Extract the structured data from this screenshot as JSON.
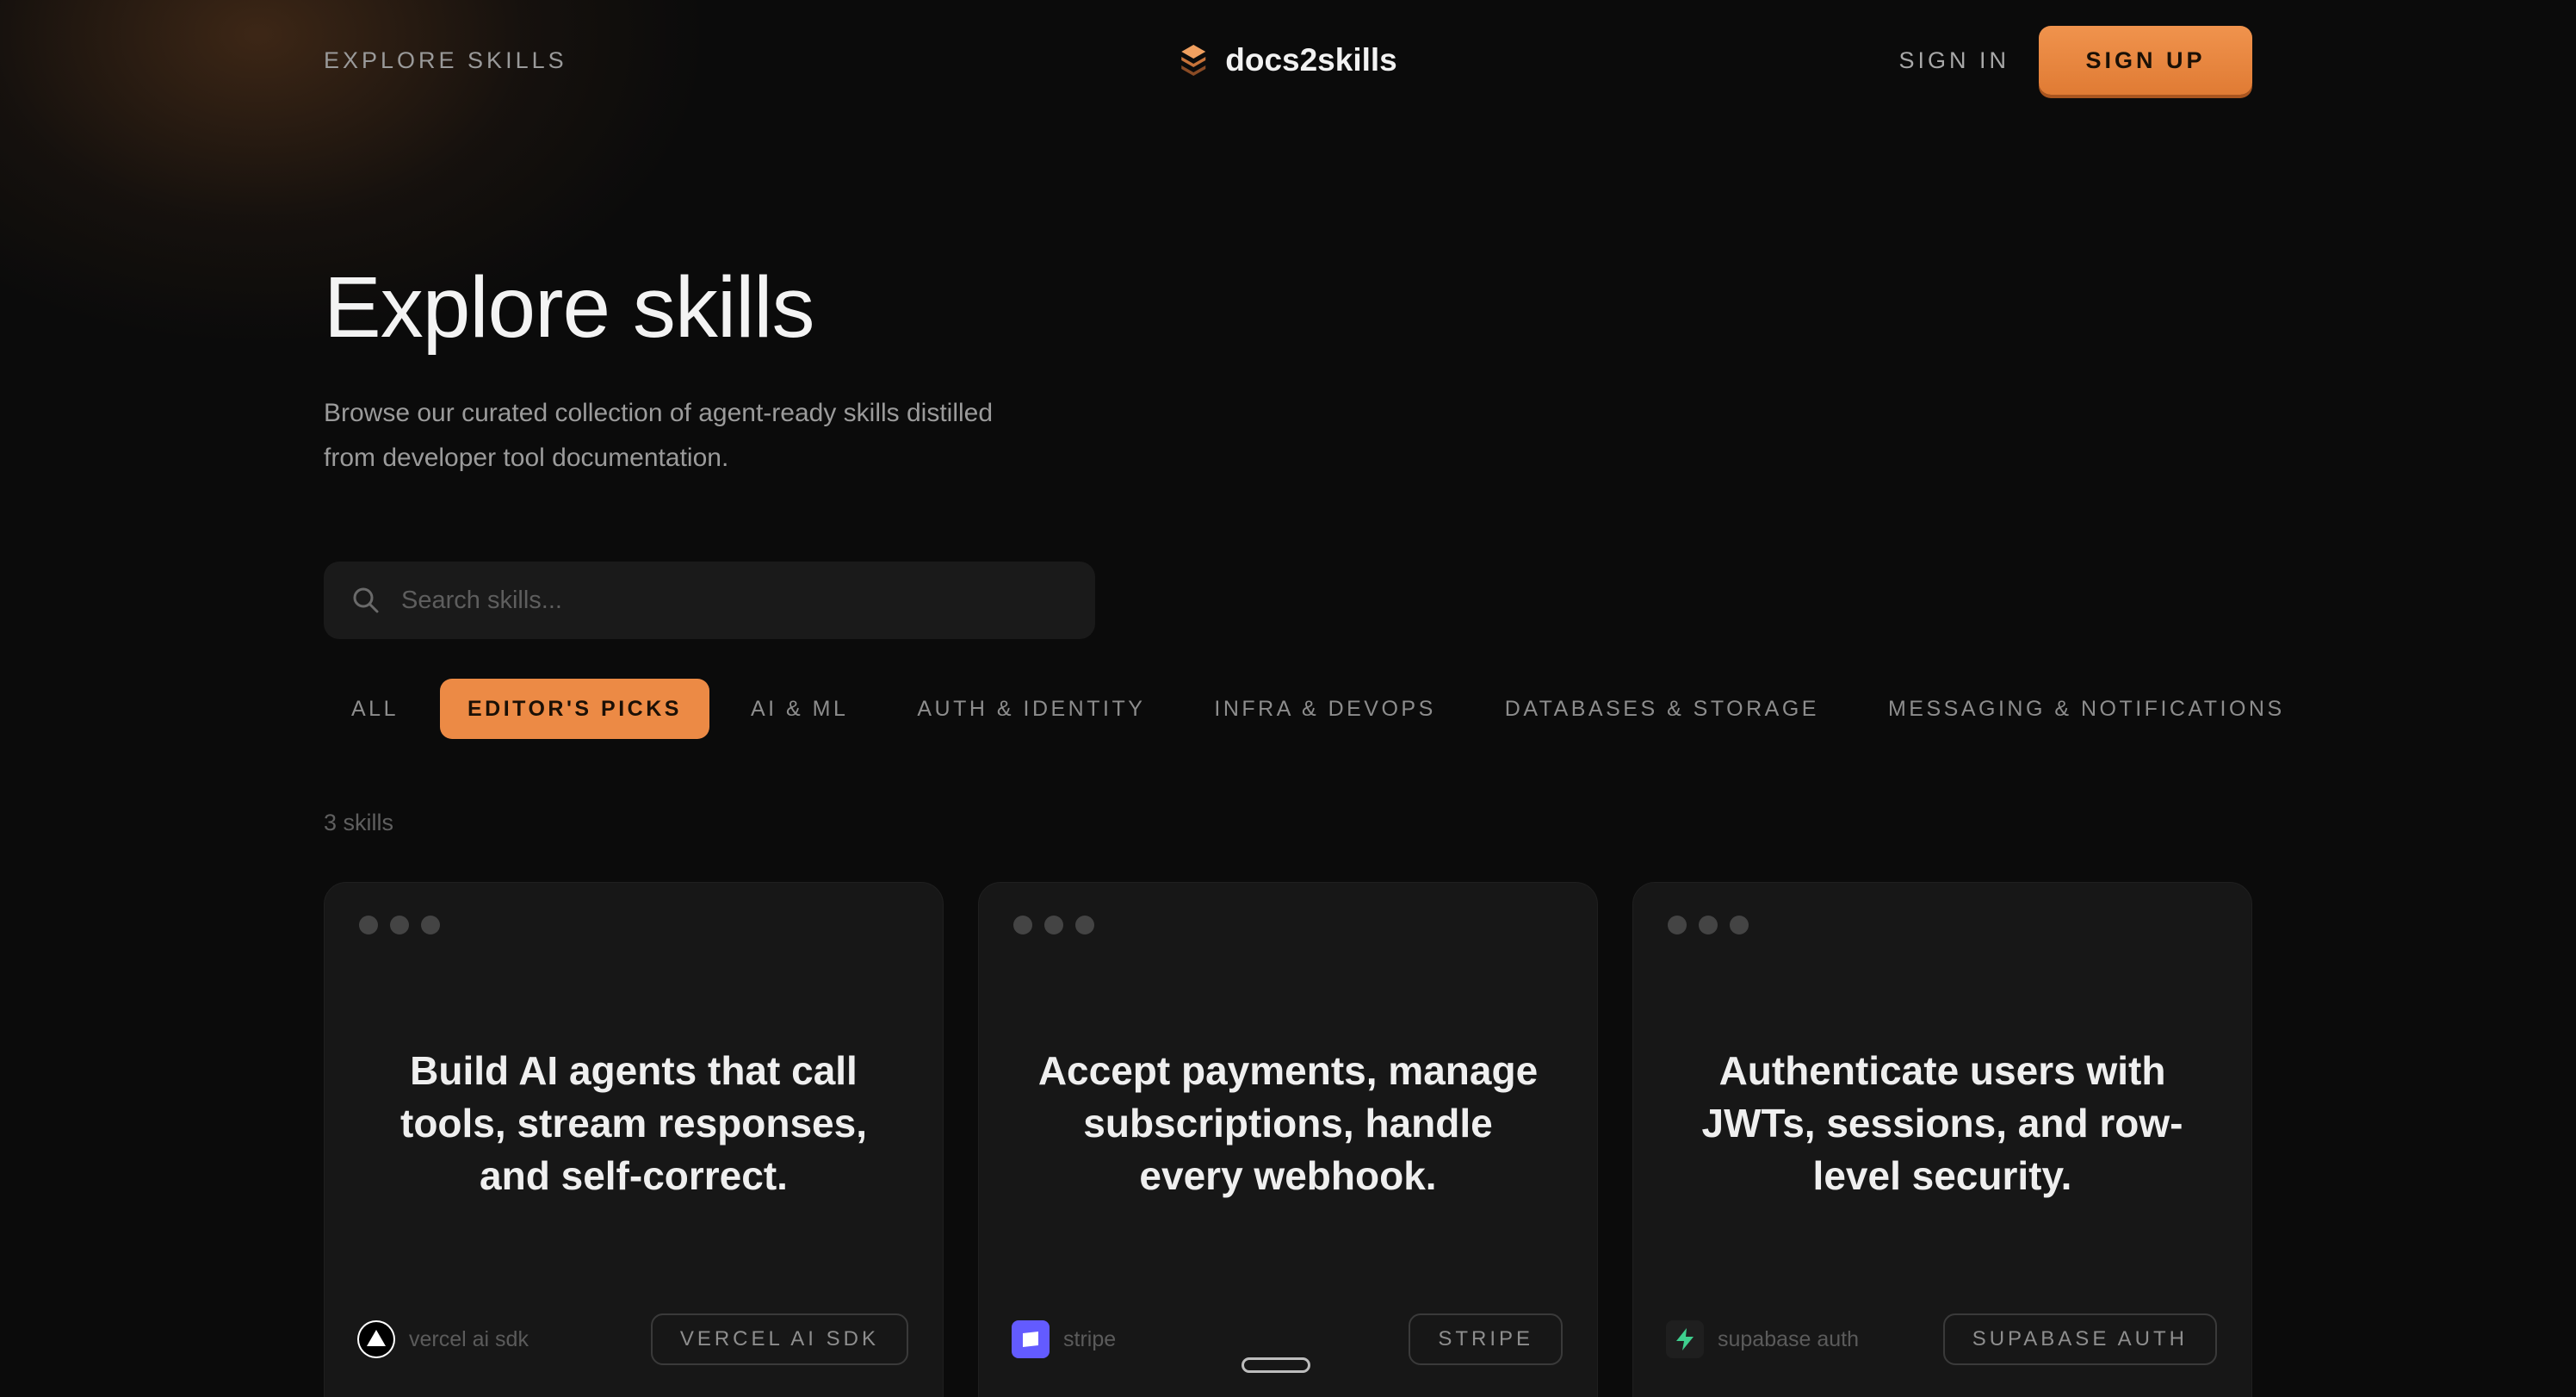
{
  "header": {
    "explore_label": "EXPLORE SKILLS",
    "brand_name": "docs2skills",
    "sign_in_label": "SIGN IN",
    "sign_up_label": "SIGN UP"
  },
  "hero": {
    "title": "Explore skills",
    "subtitle_line1": "Browse our curated collection of agent-ready skills distilled",
    "subtitle_line2": "from developer tool documentation."
  },
  "search": {
    "placeholder": "Search skills..."
  },
  "filters": [
    {
      "label": "ALL",
      "active": false
    },
    {
      "label": "EDITOR'S PICKS",
      "active": true
    },
    {
      "label": "AI & ML",
      "active": false
    },
    {
      "label": "AUTH & IDENTITY",
      "active": false
    },
    {
      "label": "INFRA & DEVOPS",
      "active": false
    },
    {
      "label": "DATABASES & STORAGE",
      "active": false
    },
    {
      "label": "MESSAGING & NOTIFICATIONS",
      "active": false
    }
  ],
  "results_count": "3 skills",
  "cards": [
    {
      "headline": "Build AI agents that call tools, stream responses, and self-correct.",
      "vendor": "vercel ai sdk",
      "vendor_icon": "vercel-triangle-icon",
      "tag": "VERCEL AI SDK"
    },
    {
      "headline": "Accept payments, manage subscriptions, handle every webhook.",
      "vendor": "stripe",
      "vendor_icon": "stripe-icon",
      "tag": "STRIPE"
    },
    {
      "headline": "Authenticate users with JWTs, sessions, and row-level security.",
      "vendor": "supabase auth",
      "vendor_icon": "supabase-bolt-icon",
      "tag": "SUPABASE AUTH"
    }
  ],
  "colors": {
    "accent": "#ec8a45",
    "background": "#0b0b0b",
    "card": "#171717"
  }
}
